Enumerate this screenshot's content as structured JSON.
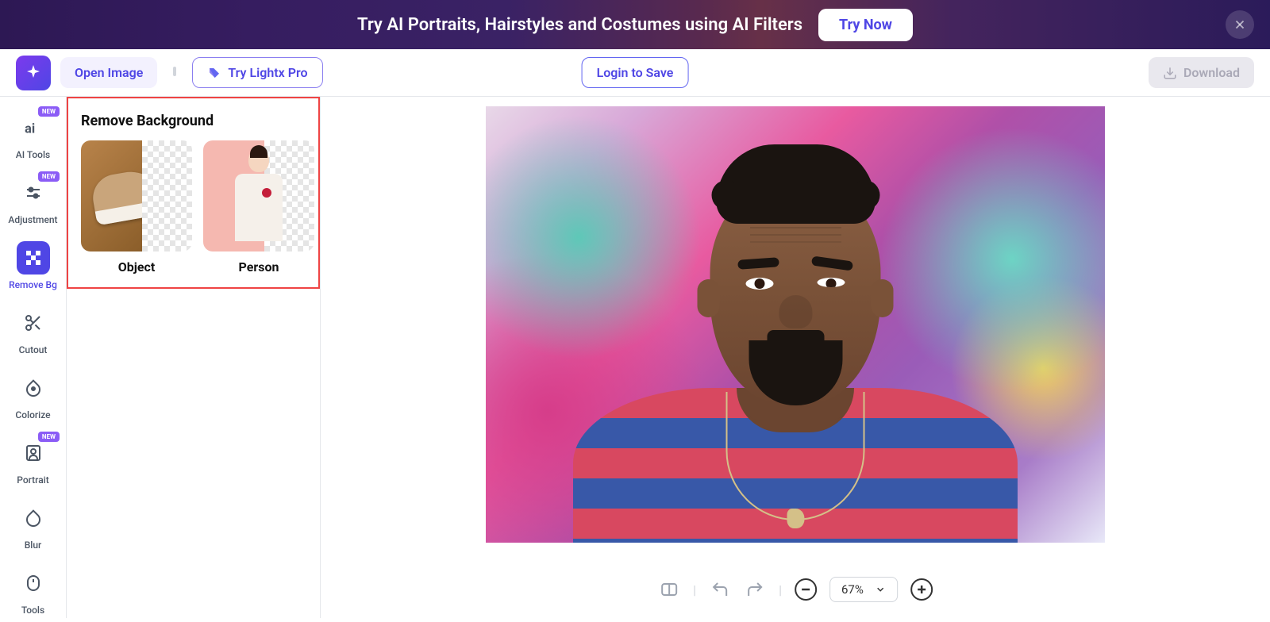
{
  "banner": {
    "text": "Try AI Portraits, Hairstyles and Costumes using AI Filters",
    "button": "Try Now"
  },
  "header": {
    "open_image": "Open Image",
    "try_pro": "Try Lightx Pro",
    "login_save": "Login to Save",
    "download": "Download"
  },
  "sidebar": {
    "items": [
      {
        "label": "AI Tools",
        "badge": "NEW"
      },
      {
        "label": "Adjustment",
        "badge": "NEW"
      },
      {
        "label": "Remove Bg",
        "badge": null
      },
      {
        "label": "Cutout",
        "badge": null
      },
      {
        "label": "Colorize",
        "badge": null
      },
      {
        "label": "Portrait",
        "badge": "NEW"
      },
      {
        "label": "Blur",
        "badge": null
      },
      {
        "label": "Tools",
        "badge": null
      }
    ]
  },
  "panel": {
    "title": "Remove Background",
    "options": [
      {
        "label": "Object"
      },
      {
        "label": "Person"
      }
    ]
  },
  "toolbar": {
    "zoom": "67%"
  }
}
